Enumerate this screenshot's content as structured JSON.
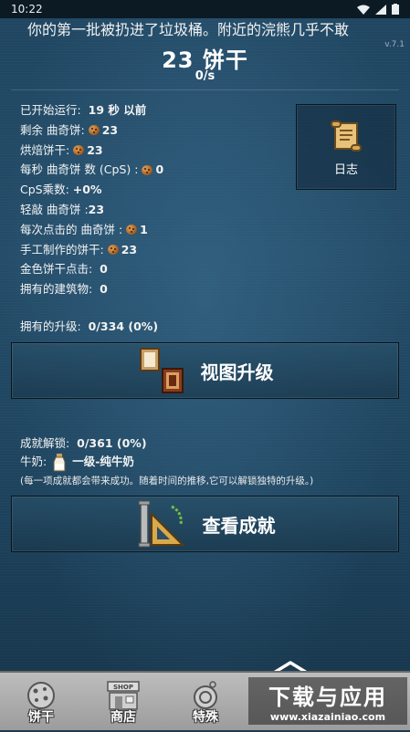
{
  "status_bar": {
    "time": "10:22"
  },
  "ticker": {
    "text": "你的第一批被扔进了垃圾桶。附近的浣熊几乎不敢"
  },
  "version": "v.7.1",
  "header": {
    "cookie_count": "23 饼干",
    "cps": "0/s"
  },
  "stats": [
    {
      "label": "已开始运行:",
      "value": "19 秒 以前",
      "icon": false
    },
    {
      "label": "剩余 曲奇饼:",
      "value": "23",
      "icon": true
    },
    {
      "label": "烘焙饼干:",
      "value": "23",
      "icon": true
    },
    {
      "label": "每秒 曲奇饼 数 (CpS) :",
      "value": "0",
      "icon": true
    },
    {
      "label": "CpS乘数:",
      "value": "+0%",
      "icon": false
    },
    {
      "label": "轻敲 曲奇饼 :",
      "value": "23",
      "icon": false
    },
    {
      "label": "每次点击的 曲奇饼 :",
      "value": "1",
      "icon": true
    },
    {
      "label": "手工制作的饼干:",
      "value": "23",
      "icon": true
    },
    {
      "label": "金色饼干点击:",
      "value": "0",
      "icon": false
    },
    {
      "label": "拥有的建筑物:",
      "value": "0",
      "icon": false
    }
  ],
  "log_button": {
    "label": "日志",
    "icon": "scroll-icon"
  },
  "upgrades": {
    "label": "拥有的升级:",
    "value": "0/334 (0%)",
    "button_label": "视图升级",
    "icon": "upgrade-frames-icon"
  },
  "achievements": {
    "label": "成就解锁:",
    "value": "0/361 (0%)",
    "milk_label": "牛奶:",
    "milk_value": "一级-纯牛奶",
    "note": "(每一项成就都会带来成功。随着时间的推移,它可以解锁独特的升级。)",
    "button_label": "查看成就",
    "icon": "trophy-tools-icon"
  },
  "bottom_nav": {
    "items": [
      {
        "label": "饼干",
        "icon": "cookie-icon"
      },
      {
        "label": "商店",
        "icon": "shop-icon"
      },
      {
        "label": "特殊",
        "icon": "special-icon"
      }
    ]
  },
  "watermark": {
    "main": "下载与应用",
    "sub": "www.xiazainiao.com"
  }
}
